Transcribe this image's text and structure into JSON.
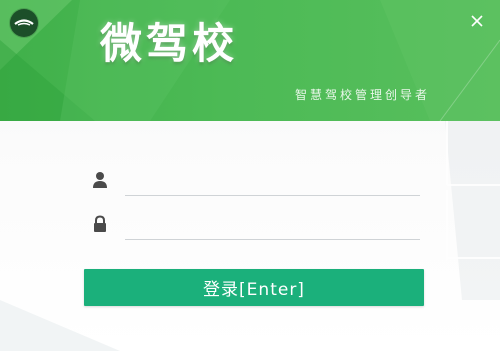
{
  "app": {
    "title": "微驾校",
    "slogan": "智慧驾校管理创导者"
  },
  "form": {
    "username": {
      "value": "",
      "placeholder": "",
      "icon": "user-icon"
    },
    "password": {
      "value": "",
      "placeholder": "",
      "icon": "lock-icon"
    },
    "login_label": "登录[Enter]"
  },
  "colors": {
    "header_green": "#4cba55",
    "button_green": "#1bb07b",
    "logo_dark": "#1c4f29"
  }
}
